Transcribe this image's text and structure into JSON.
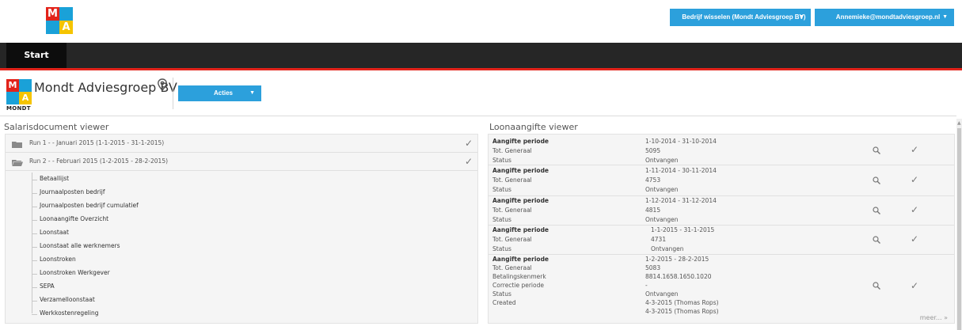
{
  "header": {
    "switch_company_label": "Bedrijf wisselen (Mondt Adviesgroep BV)",
    "user_label": "Annemieke@mondtadviesgroep.nl",
    "logo_letters": [
      "M",
      "A"
    ]
  },
  "nav": {
    "start_tab": "Start"
  },
  "company": {
    "name": "Mondt Adviesgroep BV",
    "logo_text": "MONDT",
    "actions_label": "Acties"
  },
  "salaris": {
    "title": "Salarisdocument viewer",
    "runs": [
      {
        "label": "Run 1 - - Januari 2015 (1-1-2015 - 31-1-2015)"
      },
      {
        "label": "Run 2 - - Februari 2015 (1-2-2015 - 28-2-2015)"
      }
    ],
    "documents": [
      "Betaallijst",
      "Journaalposten bedrijf",
      "Journaalposten bedrijf cumulatief",
      "Loonaangifte Overzicht",
      "Loonstaat",
      "Loonstaat alle werknemers",
      "Loonstroken",
      "Loonstroken Werkgever",
      "SEPA",
      "Verzamelloonstaat",
      "Werkkostenregeling"
    ]
  },
  "loonaangifte": {
    "title": "Loonaangifte viewer",
    "entries": [
      {
        "rows": [
          [
            "Aangifte periode",
            "1-10-2014 - 31-10-2014"
          ],
          [
            "Tot. Generaal",
            "5095"
          ],
          [
            "Status",
            "Ontvangen"
          ]
        ]
      },
      {
        "rows": [
          [
            "Aangifte periode",
            "1-11-2014 - 30-11-2014"
          ],
          [
            "Tot. Generaal",
            "4753"
          ],
          [
            "Status",
            "Ontvangen"
          ]
        ]
      },
      {
        "rows": [
          [
            "Aangifte periode",
            "1-12-2014 - 31-12-2014"
          ],
          [
            "Tot. Generaal",
            "4815"
          ],
          [
            "Status",
            "Ontvangen"
          ]
        ]
      },
      {
        "rows": [
          [
            "Aangifte periode",
            "1-1-2015 - 31-1-2015"
          ],
          [
            "Tot. Generaal",
            "4731"
          ],
          [
            "Status",
            "Ontvangen"
          ]
        ]
      },
      {
        "rows": [
          [
            "Aangifte periode",
            "1-2-2015 - 28-2-2015"
          ],
          [
            "Tot. Generaal",
            "5083"
          ],
          [
            "Betalingskenmerk",
            "8814.1658.1650.1020"
          ],
          [
            "Correctie periode",
            "-"
          ],
          [
            "Status",
            "Ontvangen"
          ],
          [
            "Created",
            "4-3-2015 (Thomas Rops)"
          ],
          [
            "",
            "4-3-2015 (Thomas Rops)"
          ]
        ]
      }
    ],
    "more_label": "meer..."
  },
  "icons": {
    "folder": "folder-icon",
    "check": "check-icon",
    "search": "search-icon",
    "pin": "map-pin-icon",
    "caret": "caret-down-icon"
  },
  "colors": {
    "accent_blue": "#2ca0dc",
    "brand_red": "#e2231a",
    "brand_yellow": "#f5c400",
    "nav_dark": "#262626"
  }
}
